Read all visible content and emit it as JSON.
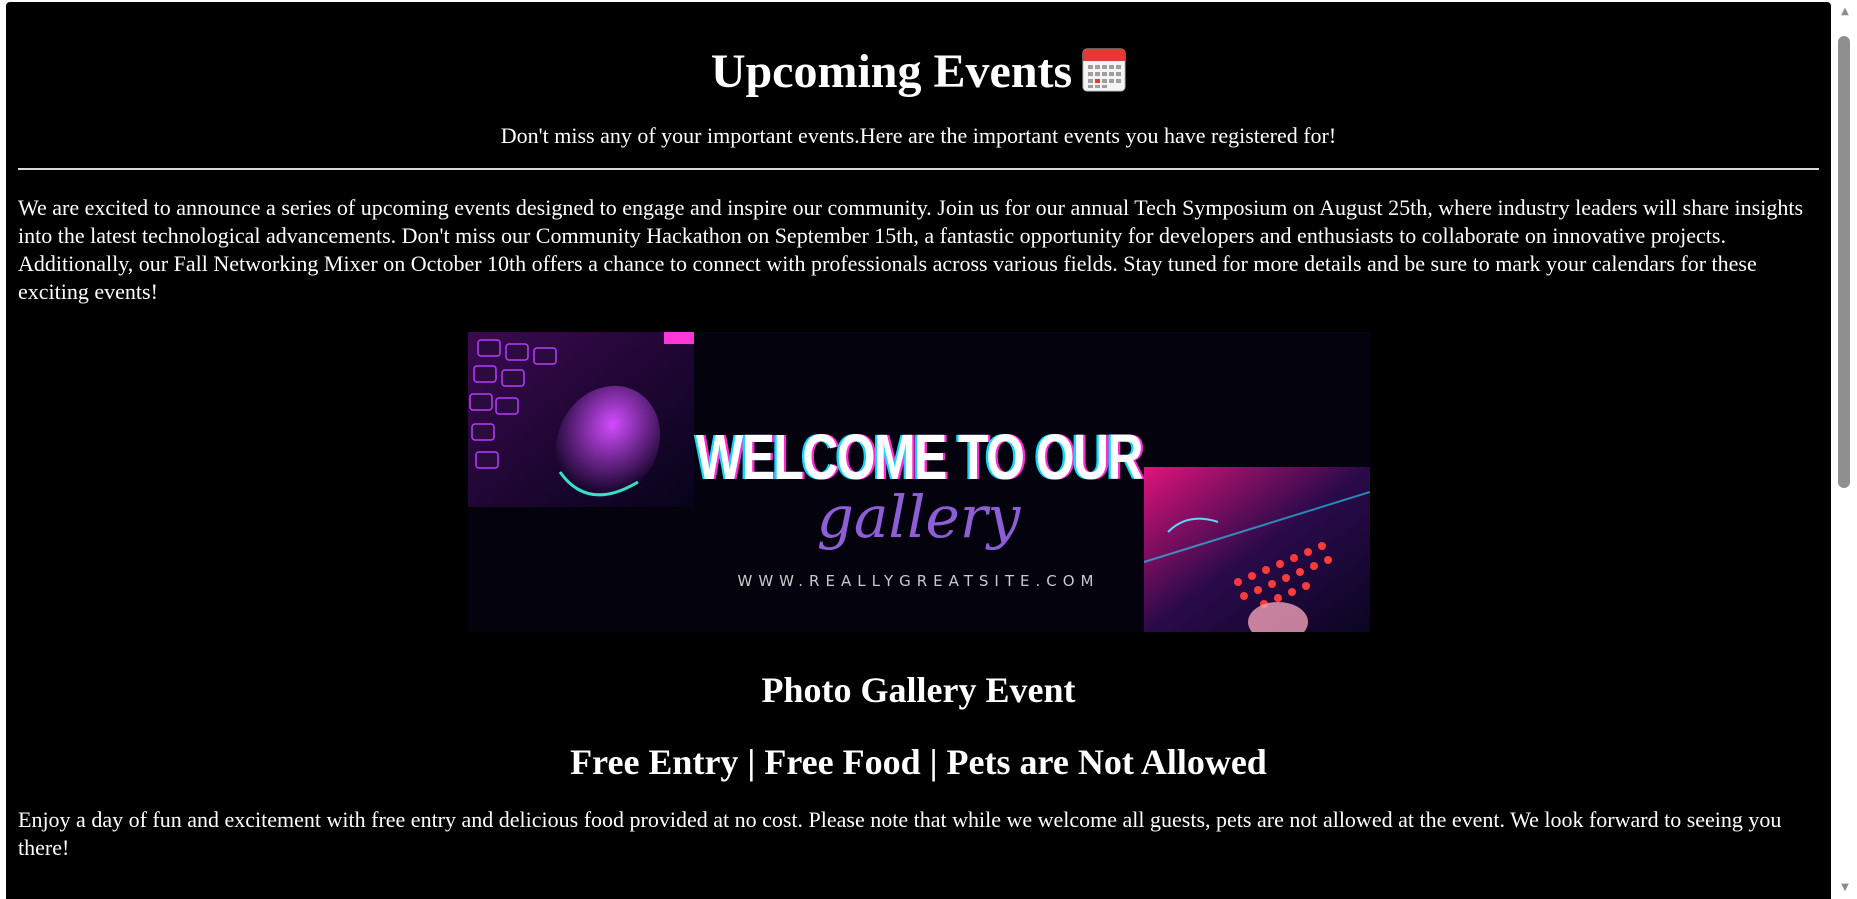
{
  "header": {
    "title": "Upcoming Events",
    "subtitle": "Don't miss any of your important events.Here are the important events you have registered for!"
  },
  "intro": {
    "text": "We are excited to announce a series of upcoming events designed to engage and inspire our community. Join us for our annual Tech Symposium on August 25th, where industry leaders will share insights into the latest technological advancements. Don't miss our Community Hackathon on September 15th, a fantastic opportunity for developers and enthusiasts to collaborate on innovative projects. Additionally, our Fall Networking Mixer on October 10th offers a chance to connect with professionals across various fields. Stay tuned for more details and be sure to mark your calendars for these exciting events!"
  },
  "banner": {
    "headline": "WELCOME TO OUR",
    "script": "gallery",
    "url": "WWW.REALLYGREATSITE.COM"
  },
  "event": {
    "name": "Photo Gallery Event",
    "perks": "Free Entry | Free Food | Pets are Not Allowed",
    "description": "Enjoy a day of fun and excitement with free entry and delicious food provided at no cost. Please note that while we welcome all guests, pets are not allowed at the event. We look forward to seeing you there!"
  },
  "icons": {
    "title_icon": "calendar-icon",
    "scroll_up": "scroll-up-arrow-icon",
    "scroll_down": "scroll-down-arrow-icon"
  },
  "colors": {
    "page_background": "#000000",
    "text": "#ffffff",
    "calendar_red": "#e53935",
    "banner_accent_pink": "#ff2ad4",
    "banner_accent_cyan": "#15d6ff",
    "banner_script": "#8e5ed6"
  }
}
